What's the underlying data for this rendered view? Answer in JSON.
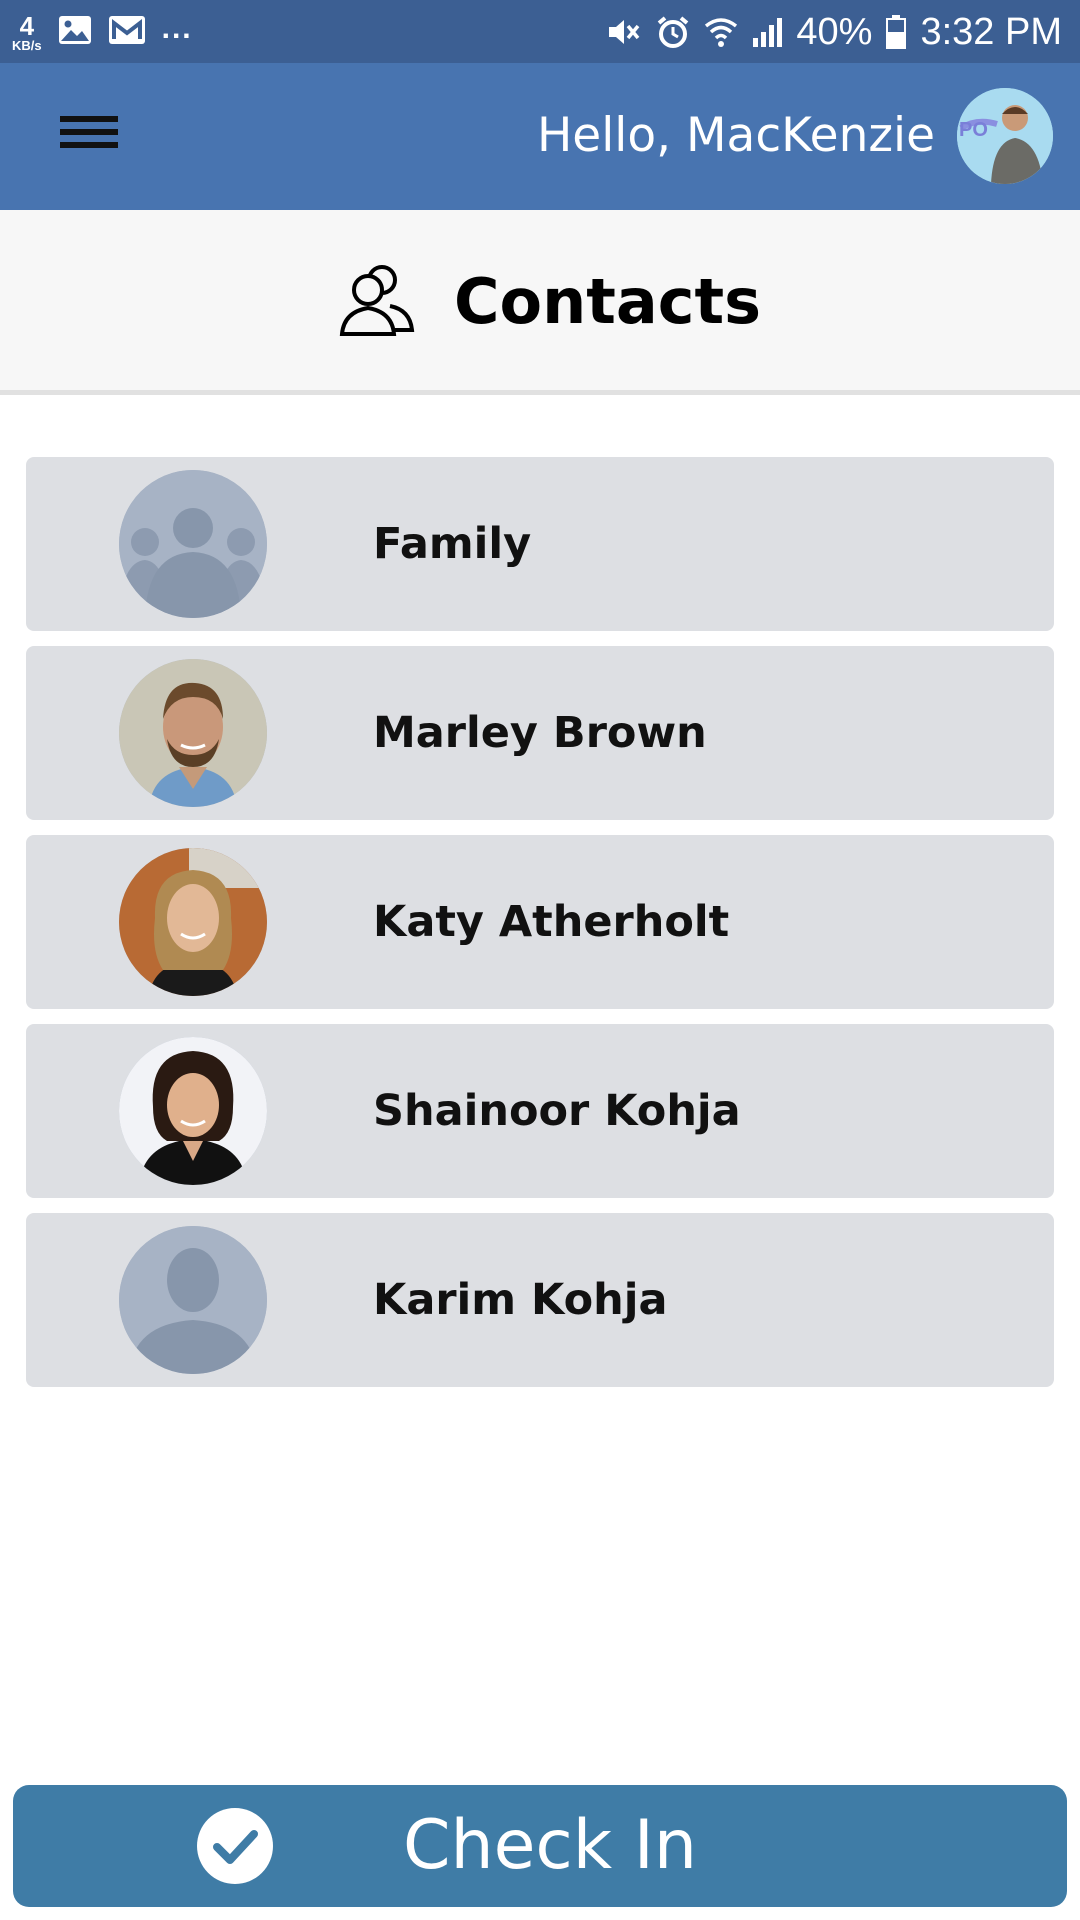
{
  "status_bar": {
    "net_speed": "4",
    "net_unit": "KB/s",
    "more_indicator": "...",
    "battery": "40%",
    "time": "3:32 PM",
    "icons": [
      "image-icon",
      "email-icon",
      "mute-icon",
      "alarm-icon",
      "wifi-icon",
      "signal-icon",
      "battery-icon"
    ]
  },
  "header": {
    "greeting": "Hello, MacKenzie",
    "menu_icon": "hamburger-menu-icon",
    "avatar_icon": "user-avatar"
  },
  "page": {
    "title": "Contacts",
    "title_icon": "contacts-icon"
  },
  "contacts": [
    {
      "name": "Family",
      "avatar": "group-placeholder-avatar"
    },
    {
      "name": "Marley Brown",
      "avatar": "photo-avatar"
    },
    {
      "name": "Katy Atherholt",
      "avatar": "photo-avatar"
    },
    {
      "name": "Shainoor Kohja",
      "avatar": "photo-avatar"
    },
    {
      "name": "Karim Kohja",
      "avatar": "person-placeholder-avatar"
    }
  ],
  "footer": {
    "checkin_label": "Check In",
    "checkin_icon": "check-circle-icon"
  },
  "colors": {
    "status_bar": "#3c5f93",
    "header": "#4874b0",
    "row_background": "#dddfe3",
    "button": "#3f7ca6"
  }
}
